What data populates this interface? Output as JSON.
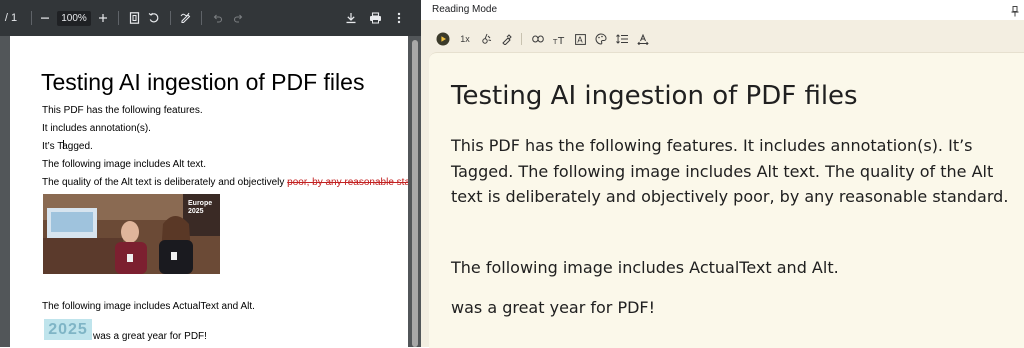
{
  "pdf_toolbar": {
    "page_info": "/ 1",
    "zoom_value": "100%"
  },
  "pdf_document": {
    "title": "Testing AI ingestion of PDF files",
    "lines": [
      "This PDF has the following features.",
      "It includes annotation(s).",
      "It’s Tagged.",
      "The following image includes Alt text."
    ],
    "alt_quality_line": "The quality of the Alt text is deliberately and objectively ",
    "struck_text": "poor, by any reasonable standa",
    "actualtext_line": "The following image includes ActualText and Alt.",
    "badge_text": "2025",
    "badge_suffix": "was a great year for PDF!",
    "photo_banner": "Europe 2025"
  },
  "reading_mode": {
    "title": "Reading Mode",
    "toolbar": {
      "speed_label": "1x"
    },
    "heading": "Testing AI ingestion of PDF files",
    "paragraphs": [
      "This PDF has the following features. It includes annotation(s). It’s Tagged. The following image includes Alt text. The quality of the Alt text is deliberately and objectively poor, by any reasonable standard.",
      "The following image includes ActualText and Alt.",
      "was a great year for PDF!"
    ]
  },
  "colors": {
    "pdf_toolbar_bg": "#323639",
    "reading_bg": "#fbf8ea",
    "strike_red": "#c22020",
    "badge_bg": "#bfe4ec"
  }
}
